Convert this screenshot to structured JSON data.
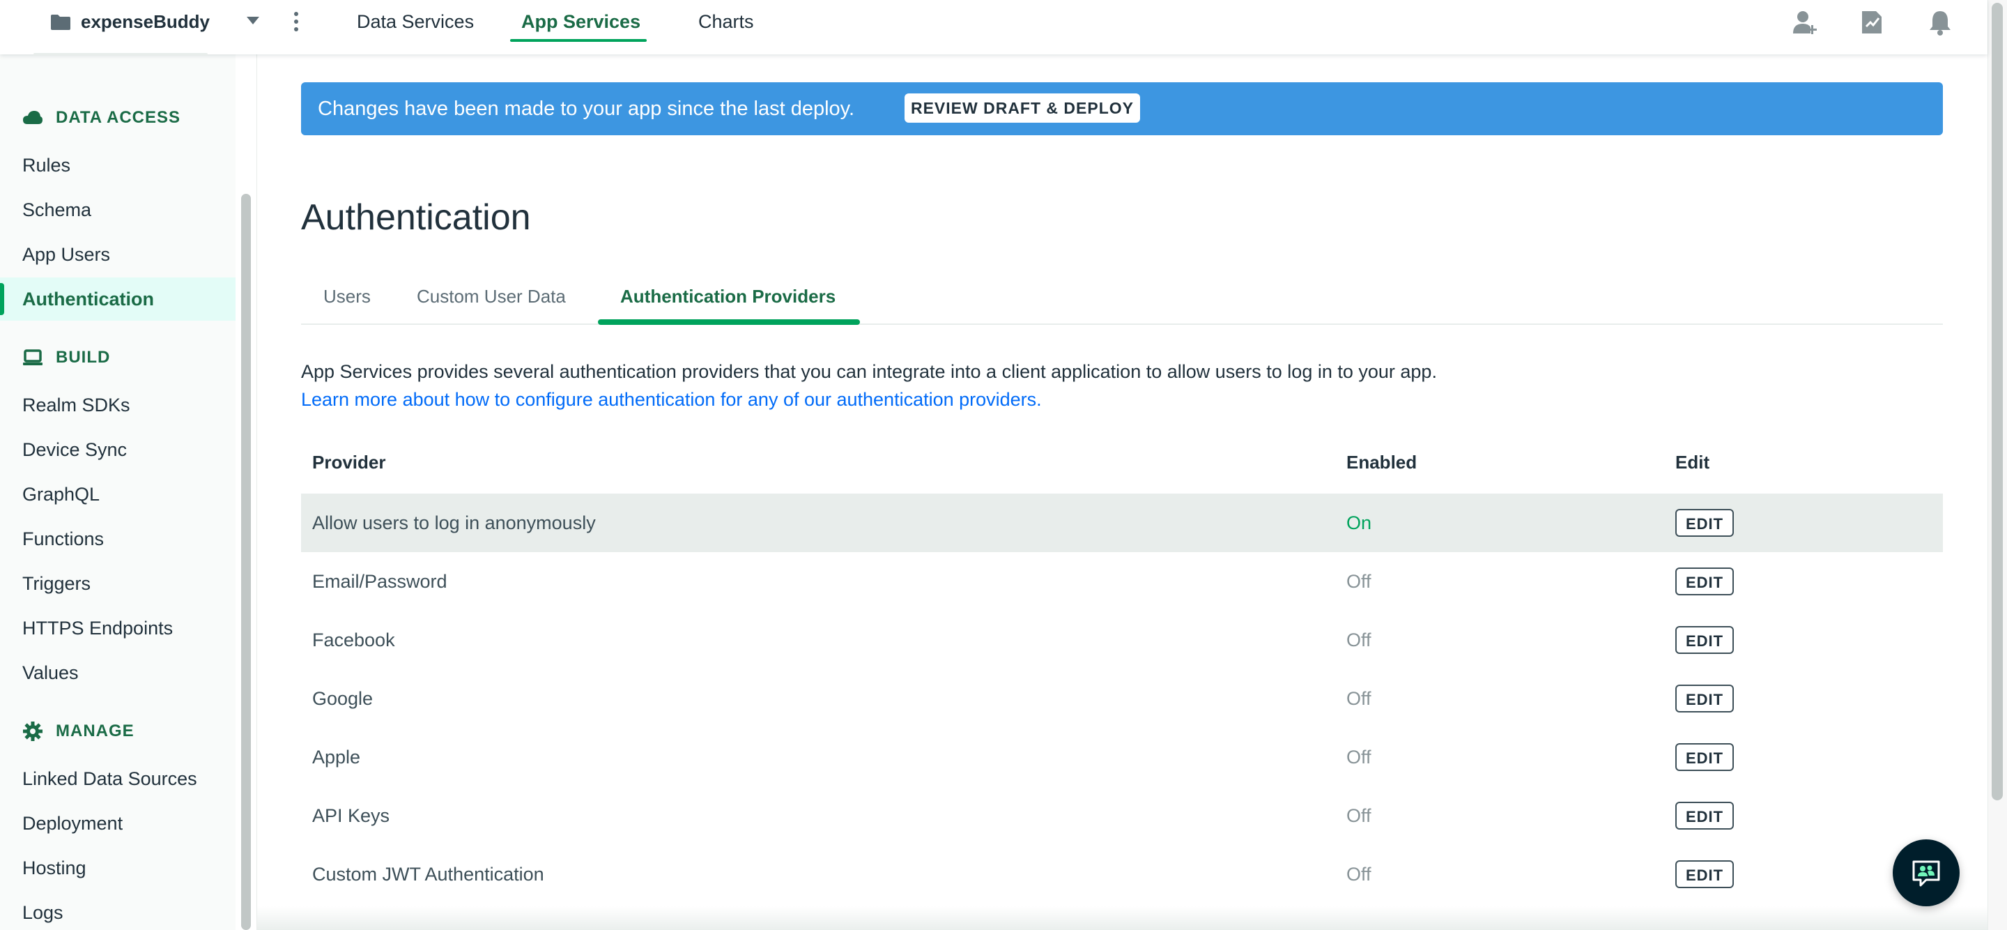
{
  "topbar": {
    "project_name": "expenseBuddy",
    "tabs": [
      {
        "label": "Data Services"
      },
      {
        "label": "App Services"
      },
      {
        "label": "Charts"
      }
    ],
    "icons": [
      "invite-user-icon",
      "activity-feed-icon",
      "notifications-bell-icon"
    ]
  },
  "sidebar": {
    "sections": [
      {
        "label": "DATA ACCESS",
        "icon": "cloud-icon"
      },
      {
        "label": "BUILD",
        "icon": "laptop-icon"
      },
      {
        "label": "MANAGE",
        "icon": "gear-icon"
      }
    ],
    "data_access_items": [
      "Rules",
      "Schema",
      "App Users",
      "Authentication"
    ],
    "build_items": [
      "Realm SDKs",
      "Device Sync",
      "GraphQL",
      "Functions",
      "Triggers",
      "HTTPS Endpoints",
      "Values"
    ],
    "manage_items": [
      "Linked Data Sources",
      "Deployment",
      "Hosting",
      "Logs"
    ],
    "active_item": "Authentication"
  },
  "banner": {
    "text": "Changes have been made to your app since the last deploy.",
    "button_label": "REVIEW DRAFT & DEPLOY",
    "color": "#3d96e1"
  },
  "page": {
    "title": "Authentication",
    "tabs": [
      "Users",
      "Custom User Data",
      "Authentication Providers"
    ],
    "active_tab": "Authentication Providers",
    "description": "App Services provides several authentication providers that you can integrate into a client application to allow users to log in to your app.",
    "learn_more": "Learn more about how to configure authentication for any of our authentication providers."
  },
  "table": {
    "headers": {
      "provider": "Provider",
      "enabled": "Enabled",
      "edit": "Edit"
    },
    "rows": [
      {
        "provider": "Allow users to log in anonymously",
        "enabled": "On",
        "edit": "EDIT"
      },
      {
        "provider": "Email/Password",
        "enabled": "Off",
        "edit": "EDIT"
      },
      {
        "provider": "Facebook",
        "enabled": "Off",
        "edit": "EDIT"
      },
      {
        "provider": "Google",
        "enabled": "Off",
        "edit": "EDIT"
      },
      {
        "provider": "Apple",
        "enabled": "Off",
        "edit": "EDIT"
      },
      {
        "provider": "API Keys",
        "enabled": "Off",
        "edit": "EDIT"
      },
      {
        "provider": "Custom JWT Authentication",
        "enabled": "Off",
        "edit": "EDIT"
      }
    ]
  },
  "colors": {
    "accent": "#00a35c",
    "accent_dark": "#1a6b46",
    "link": "#016bf8"
  }
}
